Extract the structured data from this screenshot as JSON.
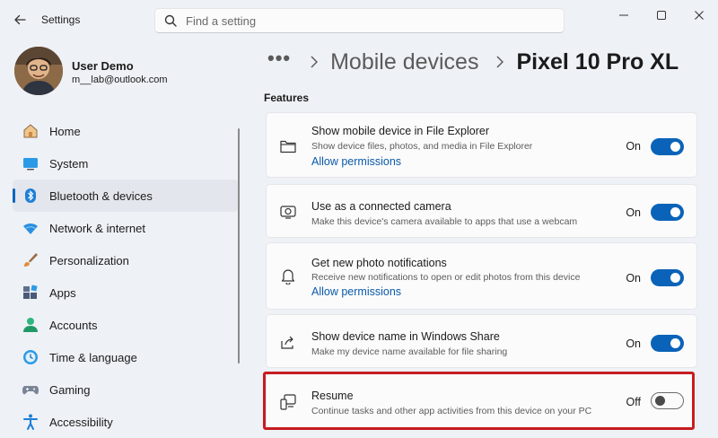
{
  "window": {
    "title": "Settings",
    "controls": [
      "minimize-icon",
      "maximize-icon",
      "close-icon"
    ]
  },
  "search": {
    "placeholder": "Find a setting",
    "value": ""
  },
  "user": {
    "name": "User Demo",
    "email": "m__lab@outlook.com"
  },
  "nav": {
    "items": [
      {
        "label": "Home",
        "icon": "home-icon",
        "active": false
      },
      {
        "label": "System",
        "icon": "system-icon",
        "active": false
      },
      {
        "label": "Bluetooth & devices",
        "icon": "bluetooth-icon",
        "active": true
      },
      {
        "label": "Network & internet",
        "icon": "network-icon",
        "active": false
      },
      {
        "label": "Personalization",
        "icon": "personalization-icon",
        "active": false
      },
      {
        "label": "Apps",
        "icon": "apps-icon",
        "active": false
      },
      {
        "label": "Accounts",
        "icon": "accounts-icon",
        "active": false
      },
      {
        "label": "Time & language",
        "icon": "time-language-icon",
        "active": false
      },
      {
        "label": "Gaming",
        "icon": "gaming-icon",
        "active": false
      },
      {
        "label": "Accessibility",
        "icon": "accessibility-icon",
        "active": false
      }
    ]
  },
  "breadcrumb": {
    "more": "•••",
    "parent": "Mobile devices",
    "current": "Pixel 10 Pro XL"
  },
  "features": {
    "title": "Features",
    "cards": [
      {
        "title": "Show mobile device in File Explorer",
        "description": "Show device files, photos, and media in File Explorer",
        "link": "Allow permissions",
        "state": "On",
        "enabled": true,
        "icon": "folder-icon"
      },
      {
        "title": "Use as a connected camera",
        "description": "Make this device's camera available to apps that use a webcam",
        "link": "",
        "state": "On",
        "enabled": true,
        "icon": "camera-icon"
      },
      {
        "title": "Get new photo notifications",
        "description": "Receive new notifications to open or edit photos from this device",
        "link": "Allow permissions",
        "state": "On",
        "enabled": true,
        "icon": "bell-icon"
      },
      {
        "title": "Show device name in Windows Share",
        "description": "Make my device name available for file sharing",
        "link": "",
        "state": "On",
        "enabled": true,
        "icon": "share-icon"
      },
      {
        "title": "Resume",
        "description": "Continue tasks and other app activities from this device on your PC",
        "link": "",
        "state": "Off",
        "enabled": false,
        "icon": "resume-devices-icon"
      }
    ]
  },
  "colors": {
    "accent": "#0a63b8",
    "link": "#0b5aa8",
    "highlight": "#c61c22",
    "background": "#eef1f6"
  }
}
